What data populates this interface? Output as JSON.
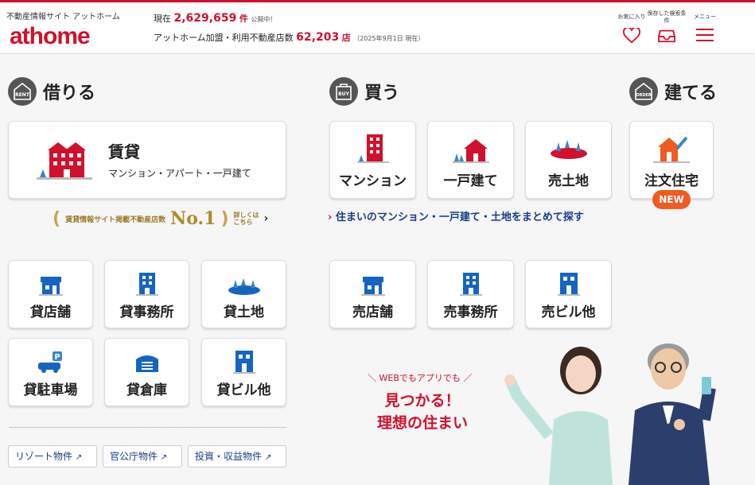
{
  "header": {
    "tagline": "不動産情報サイト アットホーム",
    "logo": "athome",
    "line1_prefix": "現在",
    "listing_count": "2,629,659",
    "listing_unit": "件",
    "listing_suffix": "公開中！",
    "line2_prefix": "アットホーム加盟・利用不動産店数",
    "shop_count": "62,203",
    "shop_unit": "店",
    "date_note": "（2025年9月1日 現在）",
    "icons": [
      {
        "label": "お気に入り",
        "icon": "heart-icon"
      },
      {
        "label": "保存した検索条件",
        "icon": "inbox-icon"
      },
      {
        "label": "メニュー",
        "icon": "menu-icon"
      }
    ]
  },
  "rent": {
    "title": "借りる",
    "badge": "RENT",
    "main": {
      "title": "賃貸",
      "sub": "マンション・アパート・一戸建て"
    },
    "no1": {
      "text": "賃貸情報サイト掲載不動産店数",
      "rank": "No.1",
      "more": "詳しくはこちら"
    },
    "items": [
      "貸店舗",
      "貸事務所",
      "貸土地",
      "貸駐車場",
      "貸倉庫",
      "貸ビル他"
    ]
  },
  "buy": {
    "title": "買う",
    "badge": "BUY",
    "items": [
      "マンション",
      "一戸建て",
      "売土地"
    ],
    "link": "住まいのマンション・一戸建て・土地をまとめて探す",
    "items2": [
      "売店舗",
      "売事務所",
      "売ビル他"
    ]
  },
  "build": {
    "title": "建てる",
    "badge": "ORDER",
    "item": "注文住宅",
    "new": "NEW"
  },
  "links": [
    "リゾート物件",
    "官公庁物件",
    "投資・収益物件"
  ],
  "promo": {
    "sub": "WEBでもアプリでも",
    "line1": "見つかる！",
    "line2": "理想の住まい"
  },
  "colors": {
    "brand": "#d1102e",
    "blue": "#1565c0",
    "orange": "#f15a22"
  }
}
